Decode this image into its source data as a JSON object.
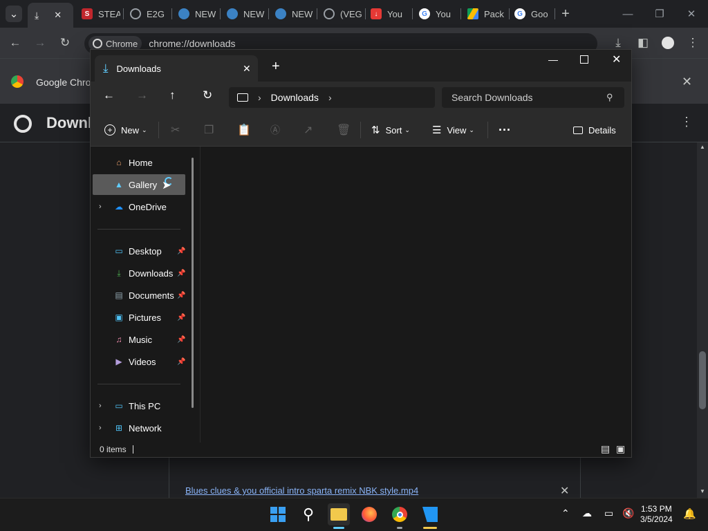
{
  "browser": {
    "tabs": [
      {
        "title": "STEA",
        "favicon": "steam-icon",
        "color": "#c1272d"
      },
      {
        "title": "E2G",
        "favicon": "globe-icon",
        "color": "#9aa0a6"
      },
      {
        "title": "NEW",
        "favicon": "edge-icon",
        "color": "#3b82c4"
      },
      {
        "title": "NEW",
        "favicon": "edge-icon",
        "color": "#3b82c4"
      },
      {
        "title": "NEW",
        "favicon": "edge-icon",
        "color": "#3b82c4"
      },
      {
        "title": "(VEG",
        "favicon": "globe-icon",
        "color": "#9aa0a6"
      },
      {
        "title": "You",
        "favicon": "download-red-icon",
        "color": "#e53935"
      },
      {
        "title": "You",
        "favicon": "google-icon",
        "color": "#ffffff"
      },
      {
        "title": "Pack",
        "favicon": "drive-icon",
        "color": "#fbbc04"
      },
      {
        "title": "Goo",
        "favicon": "google-icon",
        "color": "#ffffff"
      }
    ],
    "omnibox": {
      "chip": "Chrome",
      "url": "chrome://downloads"
    },
    "infobar_text": "Google Chrom",
    "page_title": "Downl",
    "download_file": "Blues clues & you official intro sparta remix NBK style.mp4"
  },
  "explorer": {
    "tab_title": "Downloads",
    "breadcrumb": "Downloads",
    "search_placeholder": "Search Downloads",
    "commands": {
      "new": "New",
      "sort": "Sort",
      "view": "View",
      "details": "Details"
    },
    "nav": {
      "home": "Home",
      "gallery": "Gallery",
      "onedrive": "OneDrive",
      "desktop": "Desktop",
      "downloads": "Downloads",
      "documents": "Documents",
      "pictures": "Pictures",
      "music": "Music",
      "videos": "Videos",
      "thispc": "This PC",
      "network": "Network"
    },
    "status": "0 items"
  },
  "taskbar": {
    "time": "1:53 PM",
    "date": "3/5/2024"
  },
  "colors": {
    "accent": "#60cdff",
    "folder": "#f2c94c",
    "link": "#8ab4f8"
  }
}
